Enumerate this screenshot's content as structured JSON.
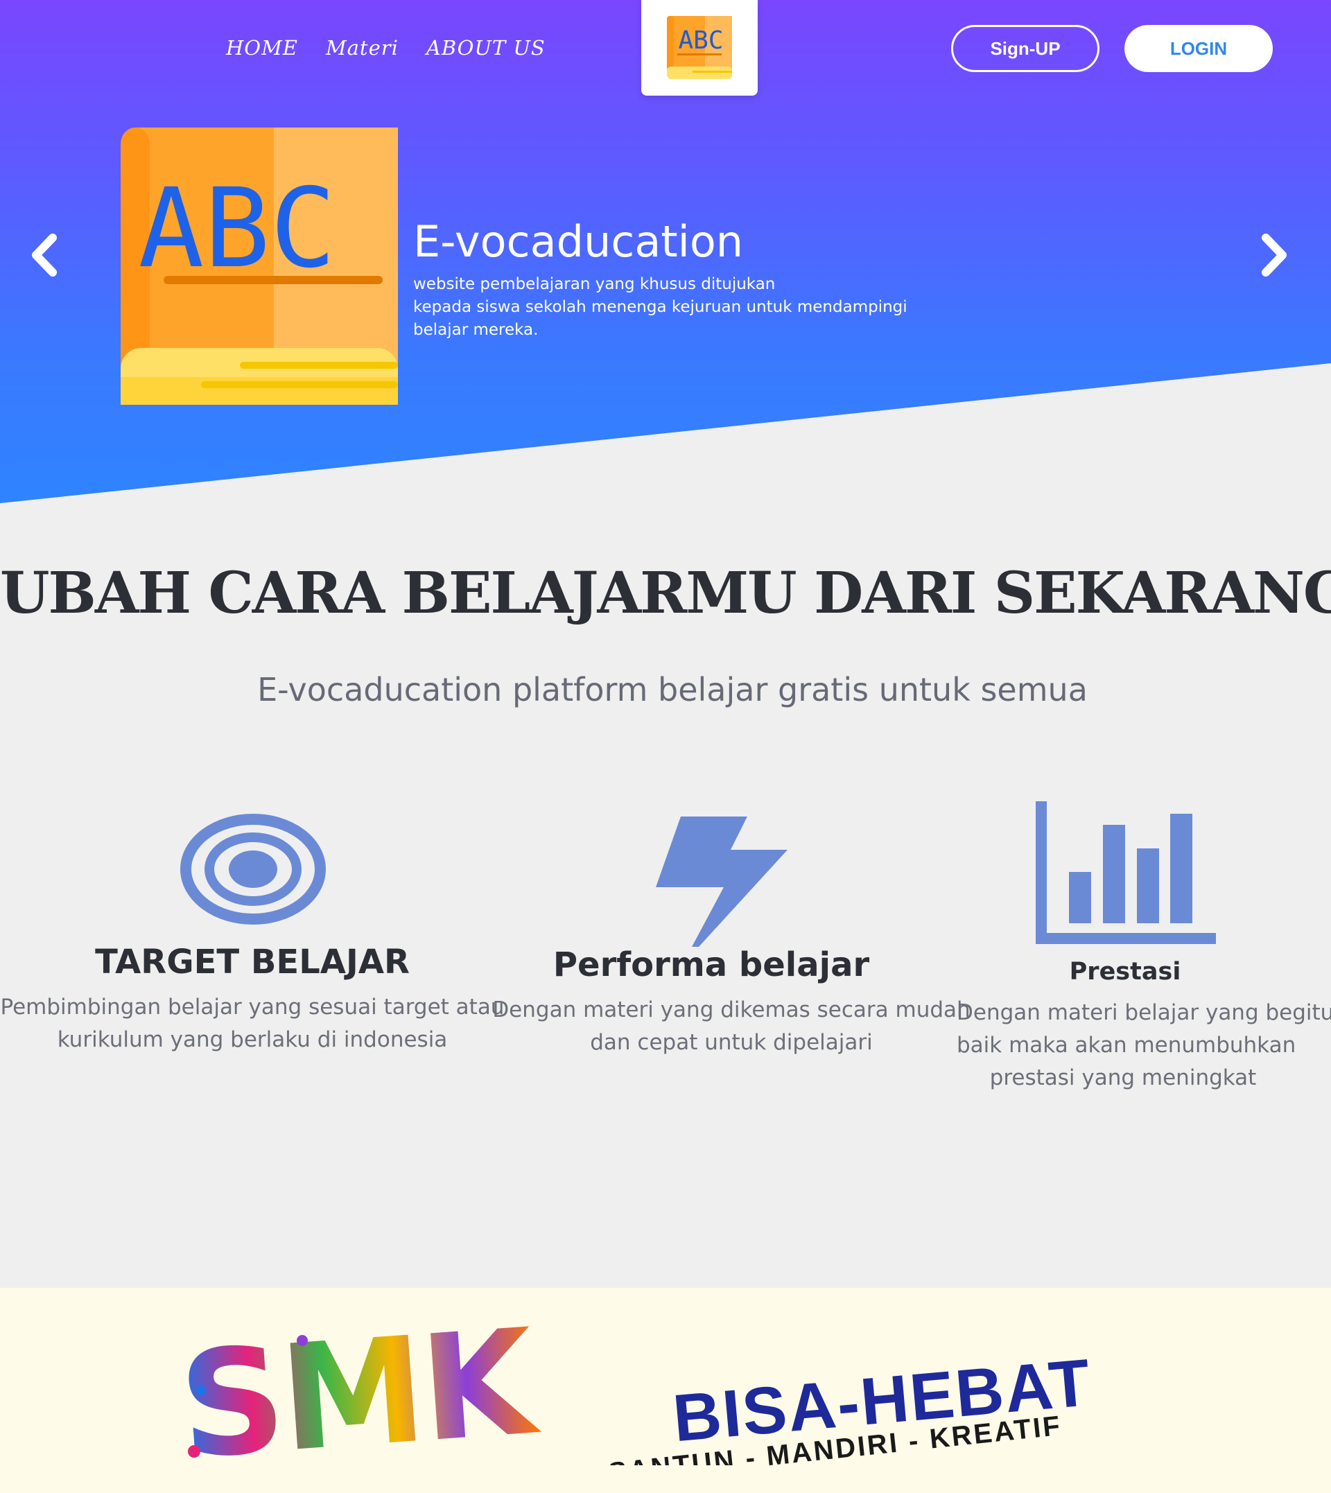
{
  "nav": {
    "items": [
      {
        "label": "HOME"
      },
      {
        "label": "Materi"
      },
      {
        "label": "ABOUT US"
      }
    ]
  },
  "logo": {
    "text": "ABC"
  },
  "auth": {
    "signup_label": "Sign-UP",
    "login_label": "LOGIN"
  },
  "hero": {
    "book_text": "ABC",
    "title": "E-vocaducation",
    "description_lines": [
      "website pembelajaran yang khusus ditujukan",
      "kepada siswa sekolah menenga kejuruan untuk mendampingi",
      "belajar mereka."
    ]
  },
  "main": {
    "headline": "UBAH CARA BELAJARMU DARI SEKARANG",
    "subheadline": "E-vocaducation platform belajar gratis untuk semua"
  },
  "features": [
    {
      "icon": "target-icon",
      "title": "TARGET BELAJAR",
      "description_lines": [
        "Pembimbingan belajar yang sesuai target atau",
        "kurikulum yang berlaku di indonesia"
      ]
    },
    {
      "icon": "lightning-icon",
      "title": "Performa belajar",
      "description_lines": [
        "Dengan materi yang dikemas secara mudah",
        "dan cepat untuk dipelajari"
      ]
    },
    {
      "icon": "bar-chart-icon",
      "title": "Prestasi",
      "description_lines": [
        "Dengan materi belajar yang begitu",
        "baik maka akan menumbuhkan",
        "prestasi yang meningkat"
      ]
    }
  ],
  "footer_banner": {
    "logo_text": "SMK",
    "slogan": "BISA-HEBAT",
    "tagline": "SIAP KERJA - SANTUN - MANDIRI - KREATIF"
  },
  "colors": {
    "hero_top": "#7a46ff",
    "hero_bottom": "#2f84ff",
    "icon_blue": "#6b8ad6",
    "book_orange": "#ffa42b",
    "text_dark": "#2c2f36"
  }
}
